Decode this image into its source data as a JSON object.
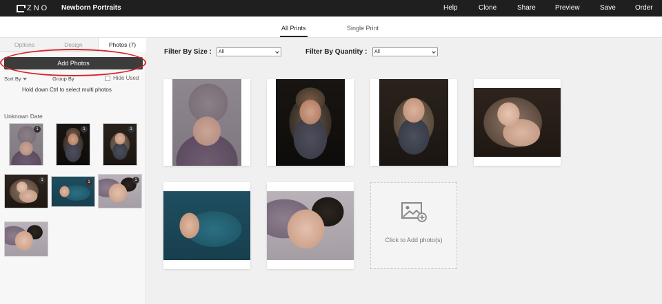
{
  "topbar": {
    "logo_text": "ZNO",
    "project_title": "Newborn Portraits",
    "nav": [
      "Help",
      "Clone",
      "Share",
      "Preview",
      "Save",
      "Order"
    ]
  },
  "print_tabs": [
    "All Prints",
    "Single Print"
  ],
  "left_panel": {
    "tabs": [
      "Options",
      "Design",
      "Photos (7)"
    ],
    "add_photos_label": "Add Photos",
    "sort_by_label": "Sort By",
    "group_by_label": "Group By",
    "hide_used_label": "Hide Used",
    "hint": "Hold down Ctrl to select multi photos",
    "date_group_label": "Unknown Date",
    "thumb_badge": "1"
  },
  "filters": {
    "size_label": "Filter By Size :",
    "size_value": "All",
    "quantity_label": "Filter By Quantity :",
    "quantity_value": "All"
  },
  "add_card": {
    "label": "Click to Add photo(s)"
  },
  "colors": {
    "topbar_bg": "#1f1f1f",
    "button_bg": "#3c3c3c",
    "highlight_ring": "#d7262b"
  }
}
